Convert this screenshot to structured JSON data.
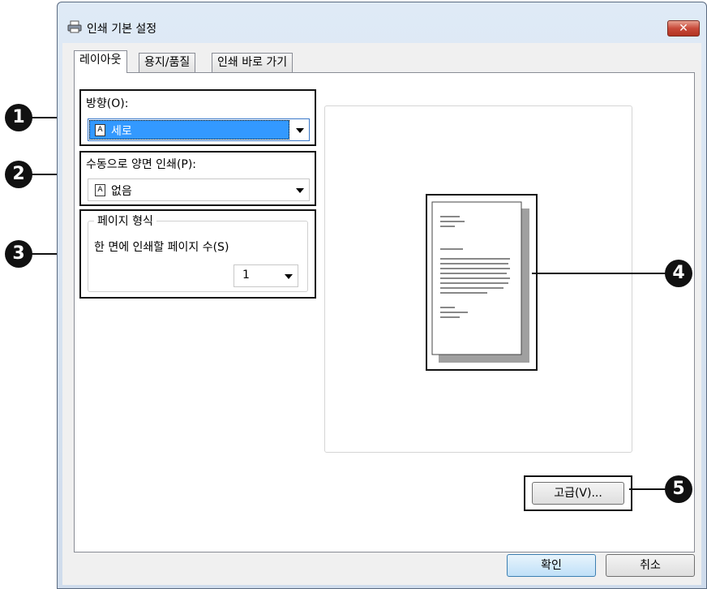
{
  "window": {
    "title": "인쇄 기본 설정",
    "close_label": "✕"
  },
  "tabs": [
    {
      "label": "레이아웃",
      "active": true
    },
    {
      "label": "용지/품질",
      "active": false
    },
    {
      "label": "인쇄 바로 가기",
      "active": false
    }
  ],
  "orientation": {
    "label": "방향(O):",
    "value": "세로",
    "icon_letter": "A"
  },
  "duplex": {
    "label": "수동으로 양면 인쇄(P):",
    "value": "없음",
    "icon_letter": "A"
  },
  "page_format": {
    "legend": "페이지 형식",
    "pages_per_side_label": "한 면에 인쇄할 페이지 수(S)",
    "pages_per_side_value": "1"
  },
  "advanced_button": "고급(V)...",
  "ok_button": "확인",
  "cancel_button": "취소",
  "markers": [
    "1",
    "2",
    "3",
    "4",
    "5"
  ],
  "colors": {
    "selection": "#3399ff",
    "marker": "#111111",
    "close": "#c84a3a"
  }
}
